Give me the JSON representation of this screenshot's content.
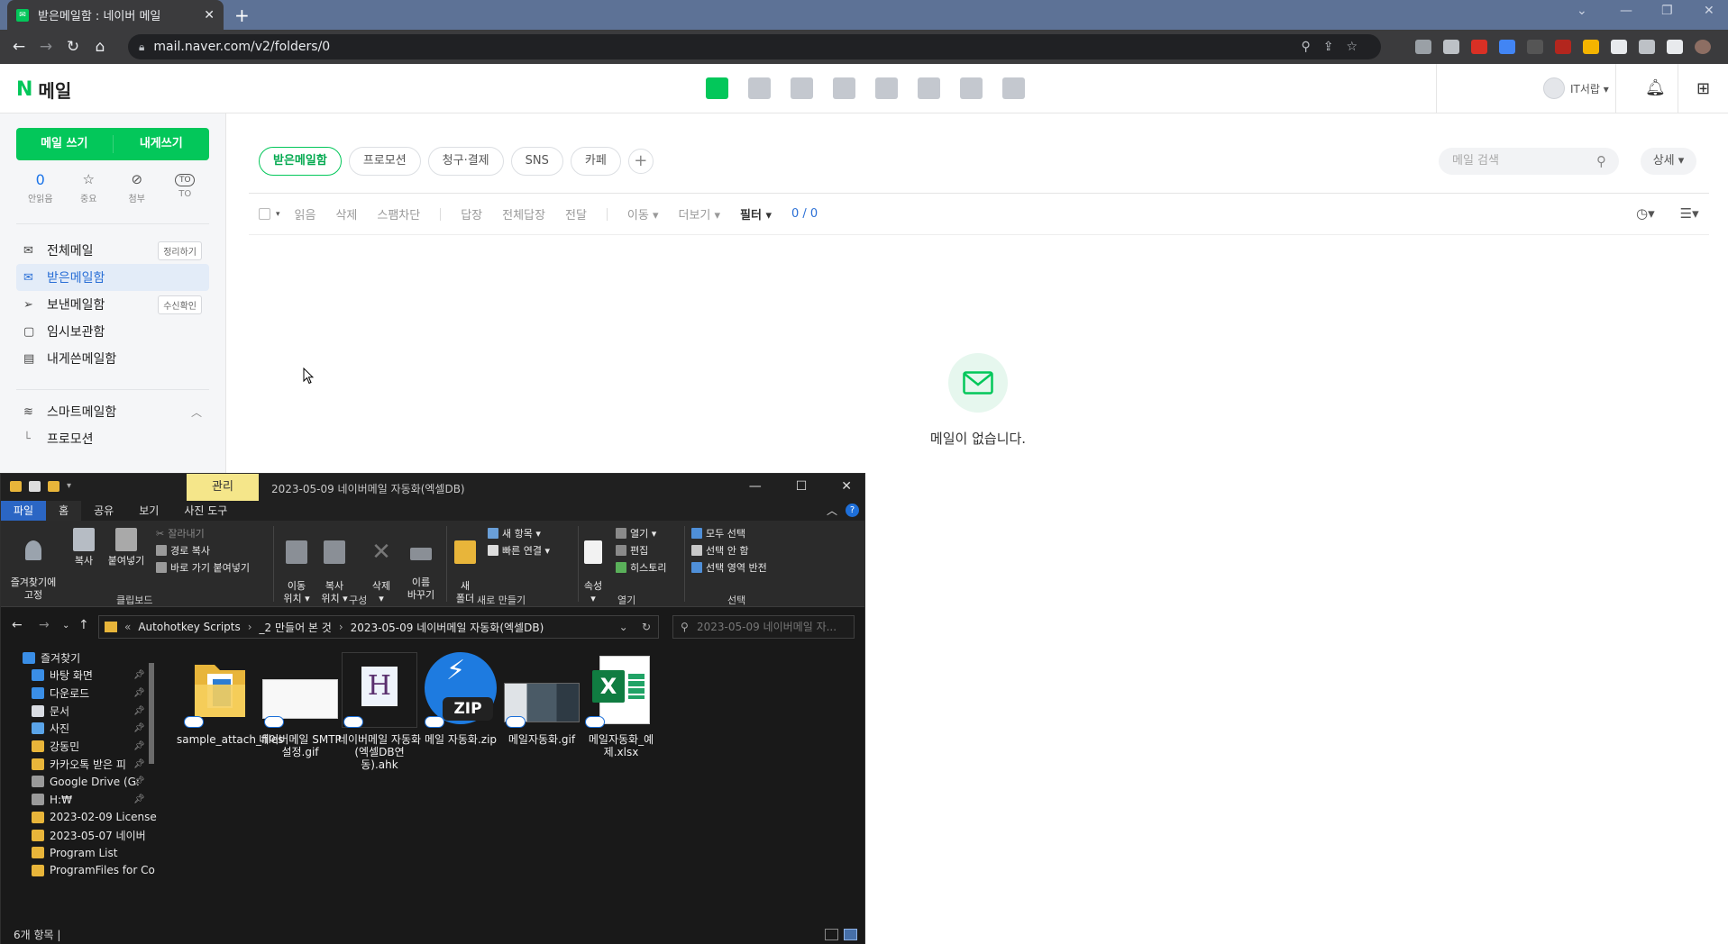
{
  "browser": {
    "tab_title": "받은메일함 : 네이버 메일",
    "url": "mail.naver.com/v2/folders/0",
    "lock_icon": "lock-icon"
  },
  "mail": {
    "logo_n": "N",
    "logo_text": "메일",
    "user_name": "IT서랍 ▾",
    "compose": {
      "write": "메일 쓰기",
      "self": "내게쓰기"
    },
    "quick": [
      {
        "value": "0",
        "label": "안읽음",
        "icon": "unread-count"
      },
      {
        "value": "☆",
        "label": "중요",
        "icon": "star-icon"
      },
      {
        "value": "⊘",
        "label": "첨부",
        "icon": "attachment-icon"
      },
      {
        "value": "TO",
        "label": "TO",
        "icon": "to-icon"
      }
    ],
    "folders": [
      {
        "label": "전체메일",
        "badge": "정리하기",
        "icon": "✉"
      },
      {
        "label": "받은메일함",
        "badge": "",
        "icon": "✉"
      },
      {
        "label": "보낸메일함",
        "badge": "수신확인",
        "icon": "➢"
      },
      {
        "label": "임시보관함",
        "badge": "",
        "icon": "▢"
      },
      {
        "label": "내게쓴메일함",
        "badge": "",
        "icon": "▤"
      }
    ],
    "smart_folder": "스마트메일함",
    "smart_sub": "프로모션",
    "tabs": [
      "받은메일함",
      "프로모션",
      "청구·결제",
      "SNS",
      "카페"
    ],
    "search_placeholder": "메일 검색",
    "detail_button": "상세 ▾",
    "toolbar": {
      "read": "읽음",
      "delete": "삭제",
      "spam": "스팸차단",
      "reply": "답장",
      "reply_all": "전체답장",
      "forward": "전달",
      "move": "이동 ▾",
      "more": "더보기 ▾",
      "filter": "필터 ▾",
      "count": "0 / 0"
    },
    "empty_message": "메일이 없습니다."
  },
  "explorer": {
    "manage_tab": "관리",
    "title": "2023-05-09 네이버메일 자동화(엑셀DB)",
    "menu": [
      "파일",
      "홈",
      "공유",
      "보기",
      "사진 도구"
    ],
    "ribbon": {
      "pin": "즐겨찾기에\n고정",
      "copy": "복사",
      "paste": "붙여넣기",
      "cut": "잘라내기",
      "copy_path": "경로 복사",
      "paste_shortcut": "바로 가기 붙여넣기",
      "move_to": "이동\n위치 ▾",
      "copy_to": "복사\n위치 ▾",
      "delete": "삭제\n▾",
      "rename": "이름\n바꾸기",
      "new_folder": "새\n폴더",
      "new_item": "새 항목 ▾",
      "easy_access": "빠른 연결 ▾",
      "properties": "속성\n▾",
      "open": "열기 ▾",
      "edit": "편집",
      "history": "히스토리",
      "select_all": "모두 선택",
      "select_none": "선택 안 함",
      "invert": "선택 영역 반전",
      "group_clipboard": "클립보드",
      "group_organize": "구성",
      "group_new": "새로 만들기",
      "group_open": "열기",
      "group_select": "선택"
    },
    "address": [
      "Autohotkey Scripts",
      "_2 만들어 본 것",
      "2023-05-09 네이버메일 자동화(엑셀DB)"
    ],
    "address_prefix": "«",
    "search_placeholder": "2023-05-09 네이버메일 자...",
    "nav": [
      {
        "label": "즐겨찾기",
        "color": "#3a8ee6",
        "pin": false
      },
      {
        "label": "바탕 화면",
        "color": "#3a8ee6",
        "pin": true
      },
      {
        "label": "다운로드",
        "color": "#3a8ee6",
        "pin": true
      },
      {
        "label": "문서",
        "color": "#d9dce2",
        "pin": true
      },
      {
        "label": "사진",
        "color": "#5aa4e8",
        "pin": true
      },
      {
        "label": "강동민",
        "color": "#e8b53a",
        "pin": true
      },
      {
        "label": "카카오톡 받은 피",
        "color": "#e8b53a",
        "pin": true
      },
      {
        "label": "Google Drive (G:",
        "color": "#9a9a9a",
        "pin": true
      },
      {
        "label": "H:₩",
        "color": "#9a9a9a",
        "pin": true
      },
      {
        "label": "2023-02-09 License",
        "color": "#e8b53a",
        "pin": false
      },
      {
        "label": "2023-05-07 네이버",
        "color": "#e8b53a",
        "pin": false
      },
      {
        "label": "Program List",
        "color": "#e8b53a",
        "pin": false
      },
      {
        "label": "ProgramFiles for Co",
        "color": "#e8b53a",
        "pin": false
      }
    ],
    "files": [
      {
        "name": "sample_attach_files",
        "kind": "folder"
      },
      {
        "name": "네이버메일 SMTP설정.gif",
        "kind": "gif-light"
      },
      {
        "name": "네이버메일 자동화(엑셀DB연동).ahk",
        "kind": "ahk"
      },
      {
        "name": "메일 자동화.zip",
        "kind": "zip"
      },
      {
        "name": "메일자동화.gif",
        "kind": "gif-dark"
      },
      {
        "name": "메일자동화_예제.xlsx",
        "kind": "xlsx"
      }
    ],
    "status": "6개 항목  |"
  }
}
